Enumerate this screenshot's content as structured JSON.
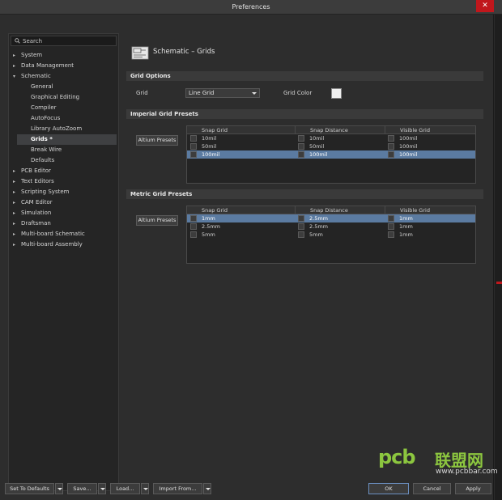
{
  "window": {
    "title": "Preferences",
    "close_glyph": "✕"
  },
  "search": {
    "placeholder": "Search"
  },
  "sidebar": {
    "items": [
      {
        "label": "System",
        "arrow": "▸",
        "child": false,
        "selected": false
      },
      {
        "label": "Data Management",
        "arrow": "▸",
        "child": false,
        "selected": false
      },
      {
        "label": "Schematic",
        "arrow": "▾",
        "child": false,
        "selected": false
      },
      {
        "label": "General",
        "arrow": "",
        "child": true,
        "selected": false
      },
      {
        "label": "Graphical Editing",
        "arrow": "",
        "child": true,
        "selected": false
      },
      {
        "label": "Compiler",
        "arrow": "",
        "child": true,
        "selected": false
      },
      {
        "label": "AutoFocus",
        "arrow": "",
        "child": true,
        "selected": false
      },
      {
        "label": "Library AutoZoom",
        "arrow": "",
        "child": true,
        "selected": false
      },
      {
        "label": "Grids *",
        "arrow": "",
        "child": true,
        "selected": true
      },
      {
        "label": "Break Wire",
        "arrow": "",
        "child": true,
        "selected": false
      },
      {
        "label": "Defaults",
        "arrow": "",
        "child": true,
        "selected": false
      },
      {
        "label": "PCB Editor",
        "arrow": "▸",
        "child": false,
        "selected": false
      },
      {
        "label": "Text Editors",
        "arrow": "▸",
        "child": false,
        "selected": false
      },
      {
        "label": "Scripting System",
        "arrow": "▸",
        "child": false,
        "selected": false
      },
      {
        "label": "CAM Editor",
        "arrow": "▸",
        "child": false,
        "selected": false
      },
      {
        "label": "Simulation",
        "arrow": "▸",
        "child": false,
        "selected": false
      },
      {
        "label": "Draftsman",
        "arrow": "▸",
        "child": false,
        "selected": false
      },
      {
        "label": "Multi-board Schematic",
        "arrow": "▸",
        "child": false,
        "selected": false
      },
      {
        "label": "Multi-board Assembly",
        "arrow": "▸",
        "child": false,
        "selected": false
      }
    ]
  },
  "page": {
    "title": "Schematic – Grids"
  },
  "grid_options": {
    "header": "Grid Options",
    "grid_label": "Grid",
    "grid_value": "Line Grid",
    "color_label": "Grid Color",
    "color_value": "#f0f0f0"
  },
  "imperial": {
    "header": "Imperial Grid Presets",
    "preset_button": "Altium Presets",
    "columns": [
      "Snap Grid",
      "Snap Distance",
      "Visible Grid"
    ],
    "rows": [
      {
        "snap": "10mil",
        "distance": "10mil",
        "visible": "100mil",
        "selected": false
      },
      {
        "snap": "50mil",
        "distance": "50mil",
        "visible": "100mil",
        "selected": false
      },
      {
        "snap": "100mil",
        "distance": "100mil",
        "visible": "100mil",
        "selected": true
      }
    ]
  },
  "metric": {
    "header": "Metric Grid Presets",
    "preset_button": "Altium Presets",
    "columns": [
      "Snap Grid",
      "Snap Distance",
      "Visible Grid"
    ],
    "rows": [
      {
        "snap": "1mm",
        "distance": "2.5mm",
        "visible": "1mm",
        "selected": true
      },
      {
        "snap": "2.5mm",
        "distance": "2.5mm",
        "visible": "1mm",
        "selected": false
      },
      {
        "snap": "5mm",
        "distance": "5mm",
        "visible": "1mm",
        "selected": false
      }
    ]
  },
  "footer": {
    "set_defaults": "Set To Defaults",
    "save": "Save...",
    "load": "Load...",
    "import_from": "Import From...",
    "ok": "OK",
    "cancel": "Cancel",
    "apply": "Apply"
  },
  "watermark": {
    "logo": "pcb",
    "cn": "联盟网",
    "url": "www.pcbbar.com"
  },
  "colors": {
    "accent_selection": "#5b7ba1",
    "close_red": "#c0171c",
    "watermark_green": "#8cc63f"
  }
}
